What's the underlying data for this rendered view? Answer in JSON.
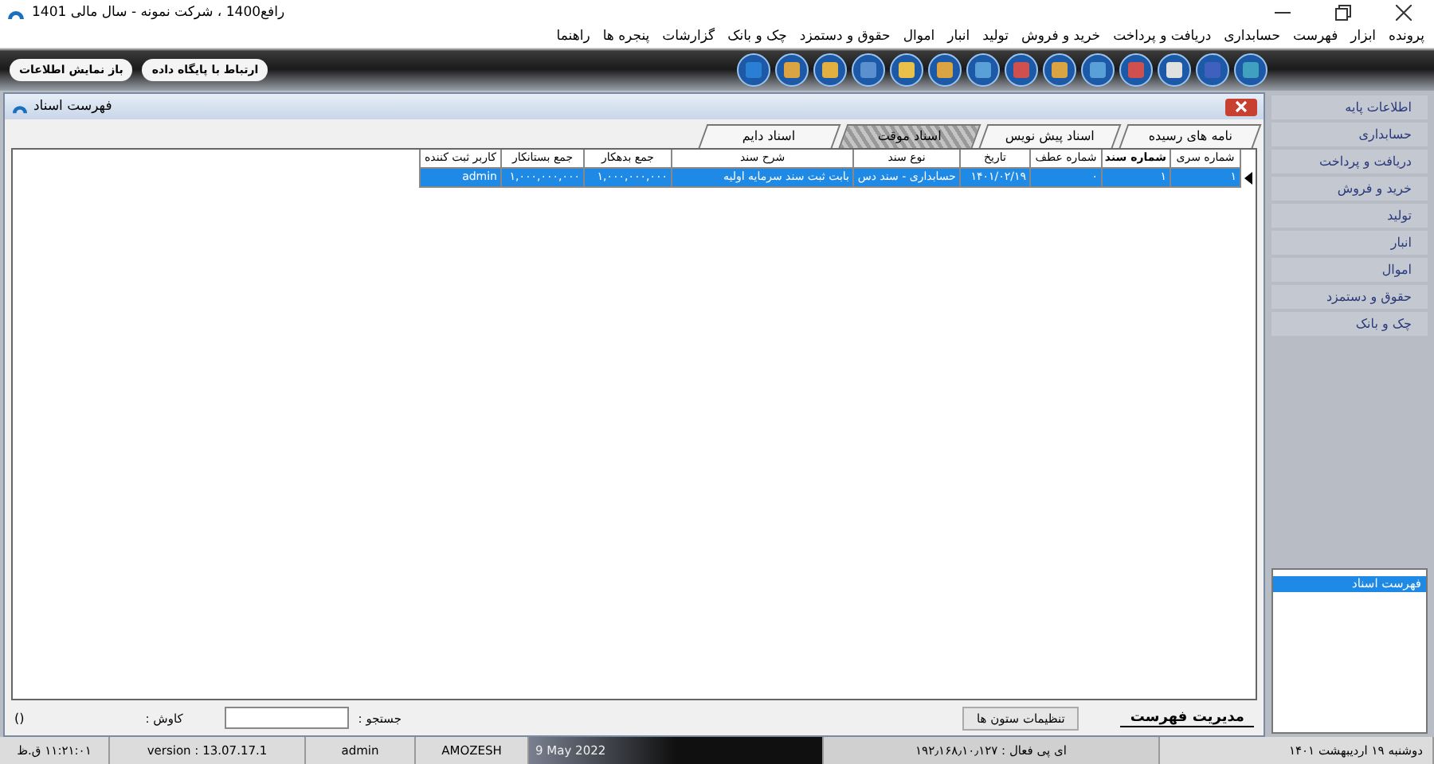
{
  "window": {
    "title": "رافع1400 ، شرکت نمونه - سال مالی 1401"
  },
  "menu": [
    "پرونده",
    "ابزار",
    "فهرست",
    "حسابداری",
    "دریافت و پرداخت",
    "خرید و فروش",
    "تولید",
    "انبار",
    "اموال",
    "حقوق و دستمزد",
    "چک و بانک",
    "گزارشات",
    "پنجره ها",
    "راهنما"
  ],
  "toolbar_buttons": [
    "ارتباط با پایگاه داده",
    "باز نمایش اطلاعات"
  ],
  "document_window": {
    "title": "فهرست اسناد",
    "tabs": [
      {
        "label": "نامه های رسیده",
        "selected": false
      },
      {
        "label": "اسناد پیش نویس",
        "selected": false
      },
      {
        "label": "اسناد موقت",
        "selected": true
      },
      {
        "label": "اسناد دایم",
        "selected": false
      }
    ],
    "table": {
      "columns": [
        {
          "label": "شماره سری",
          "bold": false
        },
        {
          "label": "شماره سند",
          "bold": true
        },
        {
          "label": "شماره عطف",
          "bold": false
        },
        {
          "label": "تاریخ",
          "bold": false
        },
        {
          "label": "نوع سند",
          "bold": false
        },
        {
          "label": "شرح سند",
          "bold": false
        },
        {
          "label": "جمع بدهکار",
          "bold": false
        },
        {
          "label": "جمع بستانکار",
          "bold": false
        },
        {
          "label": "کاربر ثبت کننده",
          "bold": false
        }
      ],
      "rows": [
        {
          "selected": true,
          "cells": [
            "۱",
            "۱",
            "۰",
            "۱۴۰۱/۰۲/۱۹",
            "حسابداری - سند دس",
            "بابت ثبت سند سرمایه اولیه",
            "۱,۰۰۰,۰۰۰,۰۰۰",
            "۱,۰۰۰,۰۰۰,۰۰۰",
            "admin"
          ]
        }
      ]
    },
    "footer": {
      "manage_tab": "مدیریت فهرست",
      "columns_button": "تنظیمات ستون ها",
      "search_label": "جستجو :",
      "explore_label": "کاوش :",
      "bracket": "()"
    }
  },
  "sidebar": {
    "items": [
      "اطلاعات پایه",
      "حسابداری",
      "دریافت و پرداخت",
      "خرید و فروش",
      "تولید",
      "انبار",
      "اموال",
      "حقوق و دستمزد",
      "چک و بانک"
    ],
    "list": [
      {
        "label": "فهرست اسناد",
        "selected": true
      }
    ]
  },
  "status_bar": [
    "دوشنبه ۱۹ اردیبهشت ۱۴۰۱",
    "ای پی فعال : ۱۹۲٫۱۶۸٫۱۰٫۱۲۷",
    "9 May 2022",
    "AMOZESH",
    "admin",
    "version : 13.07.17.1",
    "۱۱:۲۱:۰۱ ق.ظ"
  ]
}
